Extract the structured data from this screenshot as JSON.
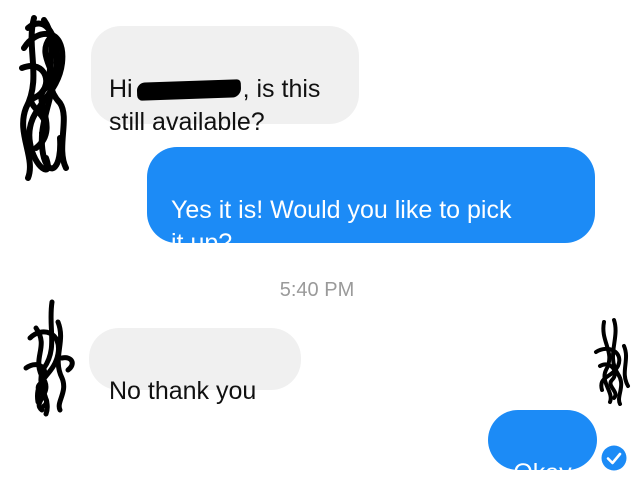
{
  "thread": {
    "messages": [
      {
        "direction": "received",
        "text_before": "Hi",
        "text_after": ", is this\nstill available?"
      },
      {
        "direction": "sent",
        "text": "Yes it is! Would you like to pick\nit up?"
      },
      {
        "direction": "received",
        "text": "No thank you"
      },
      {
        "direction": "sent",
        "text": "Okay"
      }
    ],
    "timestamp": "5:40 PM"
  },
  "colors": {
    "sent_bubble": "#1c8bf6",
    "received_bubble": "#f0f0f0",
    "timestamp": "#9a9a9a"
  },
  "icons": {
    "read_receipt": "check-circle-icon",
    "avatar": "scribbled-avatar"
  }
}
